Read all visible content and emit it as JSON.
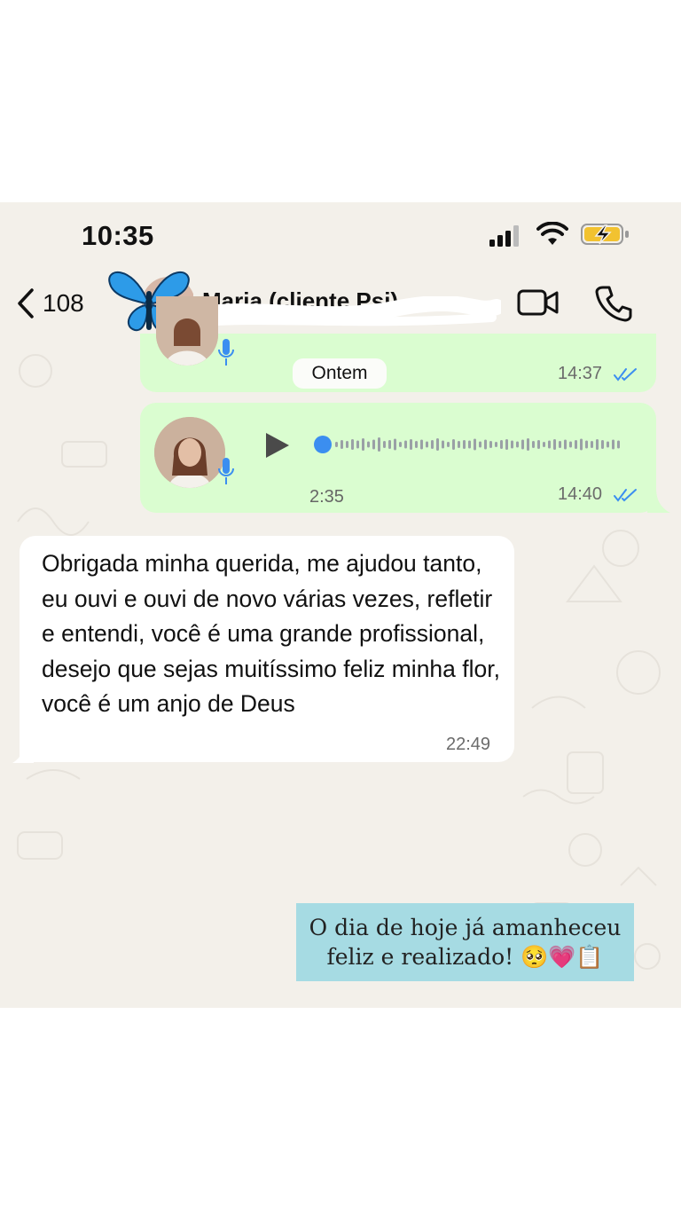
{
  "status_bar": {
    "time": "10:35"
  },
  "header": {
    "back_count": "108",
    "contact_name": "Maria (cliente Psi)"
  },
  "messages": {
    "date_chip": "Ontem",
    "voice1": {
      "time": "14:37"
    },
    "voice2": {
      "duration": "2:35",
      "time": "14:40",
      "progress": 0
    },
    "received": {
      "text": "Obrigada minha querida, me ajudou tanto, eu ouvi e ouvi de novo várias vezes, refletir e entendi, você é uma grande profissional, desejo que sejas muitíssimo feliz minha flor, você é um anjo de Deus",
      "time": "22:49"
    }
  },
  "caption": {
    "line1": "O dia de hoje já amanheceu",
    "line2": "feliz e realizado! 🥺💗📋"
  },
  "colors": {
    "outgoing_bubble": "#dafdd0",
    "incoming_bubble": "#ffffff",
    "read_ticks": "#3b8ef0",
    "caption_bg": "#a6dbe3",
    "chat_bg": "#f3f0ea"
  },
  "icons": [
    "back-chevron-icon",
    "butterfly-icon",
    "video-call-icon",
    "phone-icon",
    "play-icon",
    "mic-icon",
    "double-check-icon",
    "signal-icon",
    "wifi-icon",
    "battery-charging-icon"
  ]
}
